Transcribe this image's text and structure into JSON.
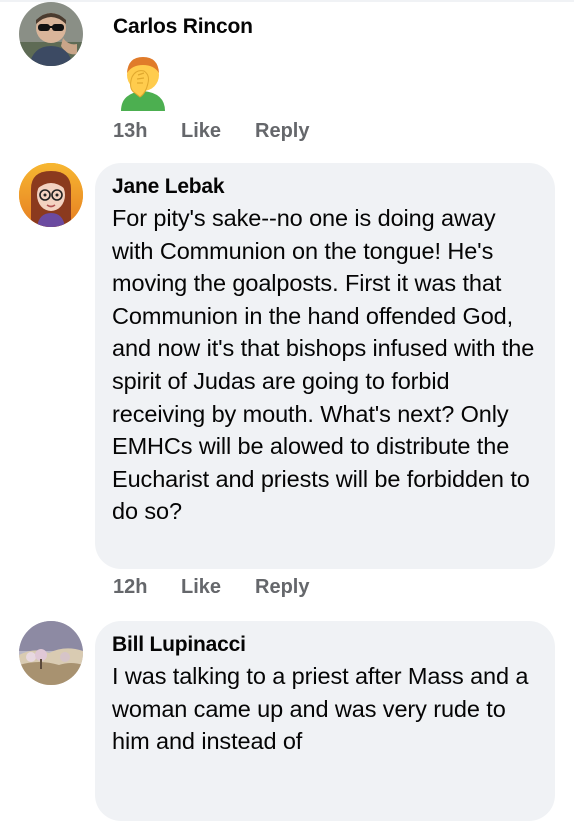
{
  "comments": [
    {
      "author": "Carlos Rincon",
      "time": "13h",
      "like_label": "Like",
      "reply_label": "Reply"
    },
    {
      "author": "Jane Lebak",
      "text": "For pity's sake--no one is doing away with Communion on the tongue! He's moving the goalposts. First it was that Communion in the hand offended God, and now it's that bishops infused with the spirit of Judas are going to forbid receiving by mouth. What's next? Only EMHCs will be alowed to distribute the Eucharist and priests will be forbidden to do so?",
      "time": "12h",
      "like_label": "Like",
      "reply_label": "Reply"
    },
    {
      "author": "Bill Lupinacci",
      "text": "I was talking to a priest after Mass and a woman came up and was very rude to him and instead of"
    }
  ],
  "colors": {
    "bubble": "#f0f2f5",
    "meta_text": "#65676b",
    "text": "#050505"
  },
  "icons": [
    "avatar-carlos",
    "facepalm-emoji",
    "avatar-jane",
    "avatar-bill"
  ]
}
